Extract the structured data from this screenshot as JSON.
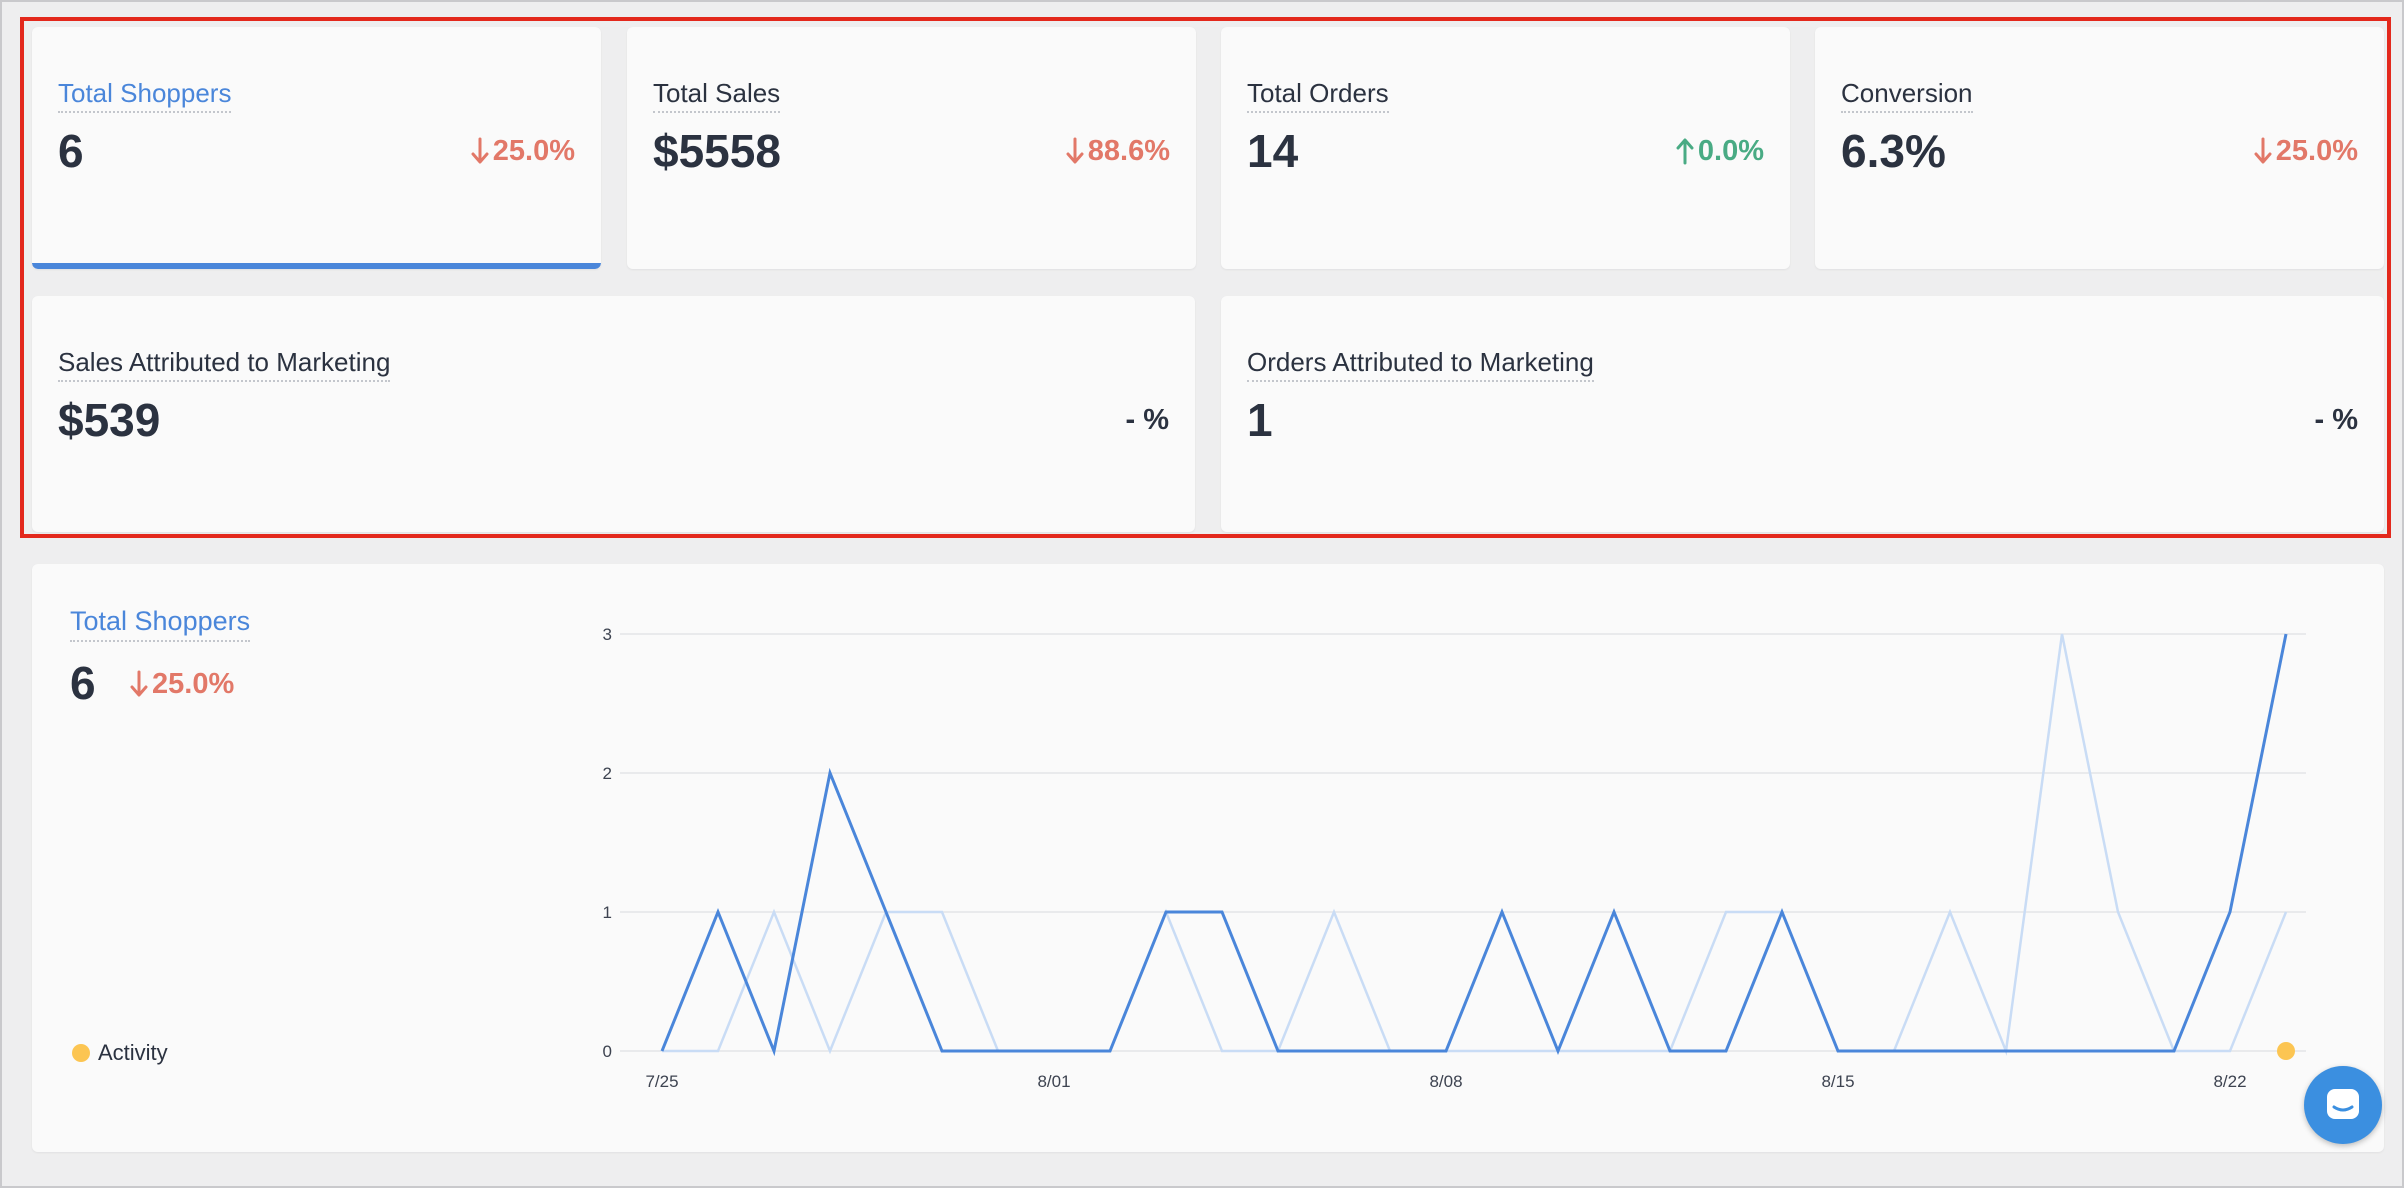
{
  "metrics": [
    {
      "label": "Total Shoppers",
      "value": "6",
      "delta": "25.0%",
      "direction": "down",
      "active": true
    },
    {
      "label": "Total Sales",
      "value": "$5558",
      "delta": "88.6%",
      "direction": "down",
      "active": false
    },
    {
      "label": "Total Orders",
      "value": "14",
      "delta": "0.0%",
      "direction": "up",
      "active": false
    },
    {
      "label": "Conversion",
      "value": "6.3%",
      "delta": "25.0%",
      "direction": "down",
      "active": false
    }
  ],
  "attributed": [
    {
      "label": "Sales Attributed to Marketing",
      "value": "$539",
      "delta": "- %"
    },
    {
      "label": "Orders Attributed to Marketing",
      "value": "1",
      "delta": "- %"
    }
  ],
  "chart_panel": {
    "title": "Total Shoppers",
    "value": "6",
    "delta": "25.0%",
    "legend_label": "Activity"
  },
  "colors": {
    "accent": "#4a86da",
    "down": "#e27868",
    "up": "#49ab84",
    "previous_series": "#c9dcf5",
    "activity": "#fcc552",
    "highlight": "#e3281c"
  },
  "icons": {
    "chat": "chat-bubble-icon",
    "arrow_down": "arrow-down-icon",
    "arrow_up": "arrow-up-icon"
  },
  "chart_data": {
    "type": "line",
    "x_tick_labels": [
      "7/25",
      "8/01",
      "8/08",
      "8/15",
      "8/22"
    ],
    "x_tick_positions": [
      0,
      7,
      14,
      21,
      28
    ],
    "y_ticks": [
      0,
      1,
      2,
      3
    ],
    "ylim": [
      0,
      3
    ],
    "xlim": [
      0,
      29
    ],
    "grid": true,
    "series": [
      {
        "role": "current",
        "color": "#4a86da",
        "values": [
          0,
          1,
          0,
          2,
          1,
          0,
          0,
          0,
          0,
          1,
          1,
          0,
          0,
          0,
          0,
          1,
          0,
          1,
          0,
          0,
          1,
          0,
          0,
          0,
          0,
          0,
          0,
          0,
          1,
          3
        ]
      },
      {
        "role": "previous",
        "color": "#c9dcf5",
        "values": [
          0,
          0,
          1,
          0,
          1,
          1,
          0,
          0,
          0,
          1,
          0,
          0,
          1,
          0,
          0,
          0,
          0,
          0,
          0,
          1,
          1,
          0,
          0,
          1,
          0,
          3,
          1,
          0,
          0,
          1
        ]
      }
    ],
    "activity_points": [
      {
        "x": 29,
        "y": 0
      }
    ]
  }
}
